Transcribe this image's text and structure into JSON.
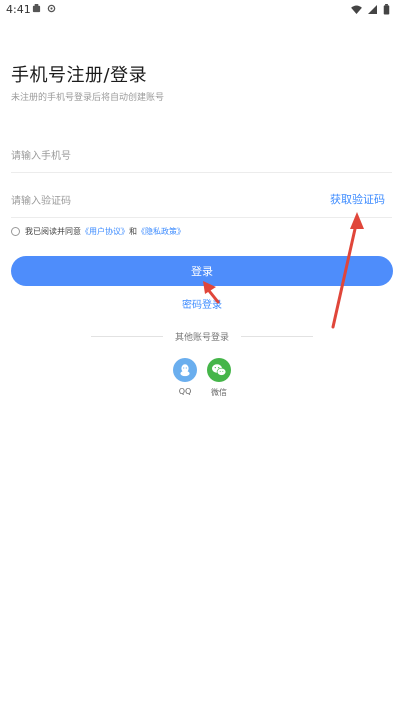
{
  "status_bar": {
    "time": "4:41"
  },
  "login": {
    "title": "手机号注册/登录",
    "subtitle": "未注册的手机号登录后将自动创建账号",
    "phone_placeholder": "请输入手机号",
    "code_placeholder": "请输入验证码",
    "get_code_label": "获取验证码",
    "agree": {
      "prefix": "我已阅读并同意",
      "user_agreement": "《用户协议》",
      "and": "和",
      "privacy_policy": "《隐私政策》"
    },
    "login_button": "登录",
    "password_login": "密码登录",
    "other_login": "其他账号登录",
    "social": [
      {
        "label": "QQ",
        "color": "#6aaeee",
        "icon": "qq-icon"
      },
      {
        "label": "微信",
        "color": "#45b549",
        "icon": "wechat-icon"
      }
    ]
  },
  "colors": {
    "accent": "#4e8dfb",
    "link": "#3c8bff",
    "annotation": "#e0463a"
  }
}
